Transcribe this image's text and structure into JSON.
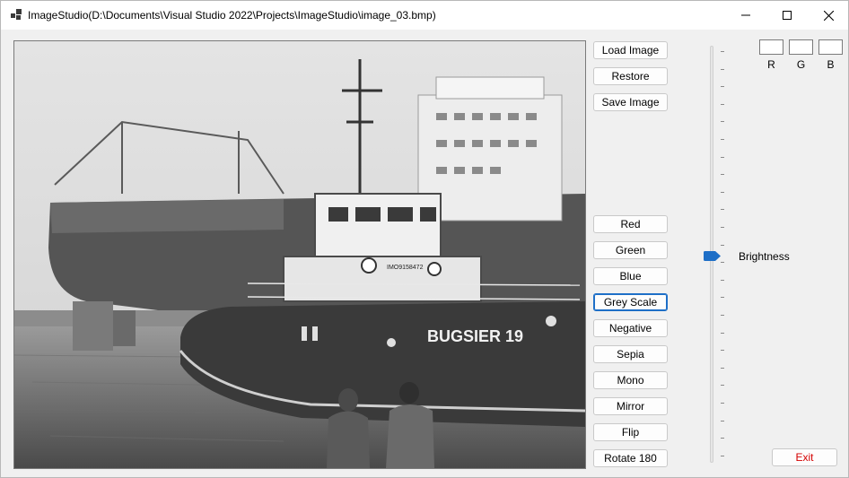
{
  "window": {
    "title": "ImageStudio(D:\\Documents\\Visual Studio 2022\\Projects\\ImageStudio\\image_03.bmp)",
    "icons": [
      "app-icon",
      "minimize-icon",
      "maximize-icon",
      "close-icon"
    ]
  },
  "image": {
    "description_text": "BUGSIER 19",
    "id_text": "IMO9158472",
    "mode": "greyscale"
  },
  "file_buttons": {
    "load": "Load Image",
    "restore": "Restore",
    "save": "Save Image"
  },
  "filter_buttons": [
    "Red",
    "Green",
    "Blue",
    "Grey Scale",
    "Negative",
    "Sepia",
    "Mono",
    "Mirror",
    "Flip",
    "Rotate 180"
  ],
  "focused_filter": "Grey Scale",
  "brightness": {
    "label": "Brightness",
    "level": 0.5
  },
  "rgb": {
    "labels": [
      "R",
      "G",
      "B"
    ],
    "values": [
      "",
      "",
      ""
    ]
  },
  "exit_label": "Exit",
  "colors": {
    "accent": "#1e6fc7",
    "exit_text": "#d40000",
    "window_bg": "#f0f0f0"
  }
}
